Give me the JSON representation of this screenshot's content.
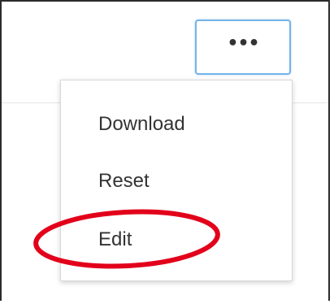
{
  "toolbar": {
    "more_button_label": "•••"
  },
  "menu": {
    "items": [
      {
        "label": "Download"
      },
      {
        "label": "Reset"
      },
      {
        "label": "Edit"
      }
    ]
  },
  "colors": {
    "button_focus_border": "#75b3e8",
    "text": "#333333",
    "annotation_circle": "#e2001a"
  },
  "icons": {
    "more_button": "ellipsis-icon"
  }
}
